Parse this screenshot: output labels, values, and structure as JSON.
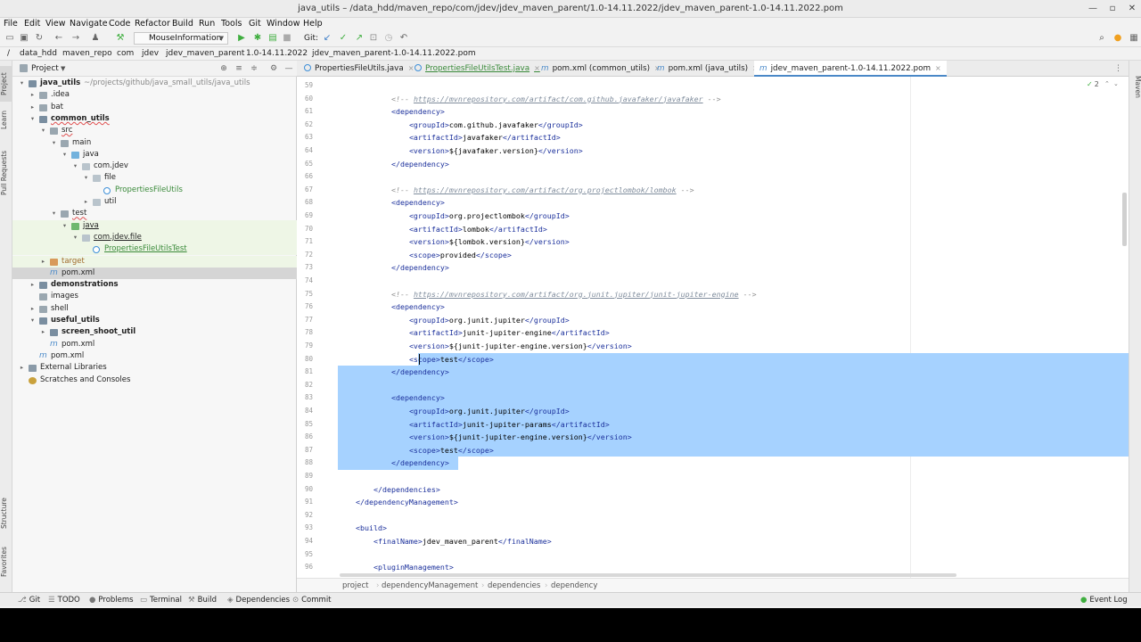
{
  "window": {
    "title": "java_utils – /data_hdd/maven_repo/com/jdev/jdev_maven_parent/1.0-14.11.2022/jdev_maven_parent-1.0-14.11.2022.pom",
    "minimize": "—",
    "maximize": "▫",
    "close": "✕"
  },
  "menu": [
    "File",
    "Edit",
    "View",
    "Navigate",
    "Code",
    "Refactor",
    "Build",
    "Run",
    "Tools",
    "Git",
    "Window",
    "Help"
  ],
  "toolbar": {
    "run_config": "MouseInformation",
    "git_label": "Git:"
  },
  "breadcrumbs": [
    "/",
    "data_hdd",
    "maven_repo",
    "com",
    "jdev",
    "jdev_maven_parent",
    "1.0-14.11.2022",
    "jdev_maven_parent-1.0-14.11.2022.pom"
  ],
  "left_strip": [
    "Project",
    "Learn",
    "Pull Requests",
    "Structure",
    "Favorites"
  ],
  "right_strip": [
    "Maven"
  ],
  "project_panel": {
    "title": "Project",
    "tree": [
      {
        "label": "java_utils",
        "suffix": "~/projects/github/java_small_utils/java_utils",
        "depth": 0,
        "arrow": "▾",
        "icon": "folder mod",
        "bold": true
      },
      {
        "label": ".idea",
        "depth": 1,
        "arrow": "▸",
        "icon": "folder"
      },
      {
        "label": "bat",
        "depth": 1,
        "arrow": "▸",
        "icon": "folder"
      },
      {
        "label": "common_utils",
        "depth": 1,
        "arrow": "▾",
        "icon": "folder mod",
        "bold": true
      },
      {
        "label": "src",
        "depth": 2,
        "arrow": "▾",
        "icon": "folder"
      },
      {
        "label": "main",
        "depth": 3,
        "arrow": "▾",
        "icon": "folder"
      },
      {
        "label": "java",
        "depth": 4,
        "arrow": "▾",
        "icon": "folder src"
      },
      {
        "label": "com.jdev",
        "depth": 5,
        "arrow": "▾",
        "icon": "pkg"
      },
      {
        "label": "file",
        "depth": 6,
        "arrow": "▾",
        "icon": "pkg"
      },
      {
        "label": "PropertiesFileUtils",
        "depth": 7,
        "arrow": "",
        "icon": "cls",
        "color": "#3a8a3a"
      },
      {
        "label": "util",
        "depth": 6,
        "arrow": "▸",
        "icon": "pkg"
      },
      {
        "label": "test",
        "depth": 3,
        "arrow": "▾",
        "icon": "folder"
      },
      {
        "label": "java",
        "depth": 4,
        "arrow": "▾",
        "icon": "folder test",
        "hl": true
      },
      {
        "label": "com.jdev.file",
        "depth": 5,
        "arrow": "▾",
        "icon": "pkg",
        "hl": true
      },
      {
        "label": "PropertiesFileUtilsTest",
        "depth": 6,
        "arrow": "",
        "icon": "cls",
        "color": "#3a8a3a",
        "hl": true
      },
      {
        "label": "target",
        "depth": 2,
        "arrow": "▸",
        "icon": "folder excl",
        "color": "#a06a2a",
        "hl": true
      },
      {
        "label": "pom.xml",
        "depth": 2,
        "arrow": "",
        "icon": "pom",
        "selected": true
      },
      {
        "label": "demonstrations",
        "depth": 1,
        "arrow": "▸",
        "icon": "folder mod",
        "bold": true
      },
      {
        "label": "images",
        "depth": 1,
        "arrow": "",
        "icon": "folder"
      },
      {
        "label": "shell",
        "depth": 1,
        "arrow": "▸",
        "icon": "folder"
      },
      {
        "label": "useful_utils",
        "depth": 1,
        "arrow": "▾",
        "icon": "folder mod",
        "bold": true
      },
      {
        "label": "screen_shoot_util",
        "depth": 2,
        "arrow": "▸",
        "icon": "folder mod",
        "bold": true
      },
      {
        "label": "pom.xml",
        "depth": 2,
        "arrow": "",
        "icon": "pom"
      },
      {
        "label": "pom.xml",
        "depth": 1,
        "arrow": "",
        "icon": "pom"
      },
      {
        "label": "External Libraries",
        "depth": 0,
        "arrow": "▸",
        "icon": "lib"
      },
      {
        "label": "Scratches and Consoles",
        "depth": 0,
        "arrow": "",
        "icon": "scr"
      }
    ]
  },
  "editor_tabs": [
    {
      "label": "PropertiesFileUtils.java",
      "kind": "class",
      "active": false
    },
    {
      "label": "PropertiesFileUtilsTest.java",
      "kind": "test",
      "active": false
    },
    {
      "label": "pom.xml (common_utils)",
      "kind": "pom",
      "active": false
    },
    {
      "label": "pom.xml (java_utils)",
      "kind": "pom",
      "active": false
    },
    {
      "label": "jdev_maven_parent-1.0-14.11.2022.pom",
      "kind": "pom",
      "active": true
    }
  ],
  "editor": {
    "inspection_count": "2",
    "lines": [
      {
        "n": "59",
        "html": ""
      },
      {
        "n": "60",
        "html": "            <span class=\"cm\">&lt;!-- <span class=\"lk\">https://mvnrepository.com/artifact/com.github.javafaker/javafaker</span> --&gt;</span>"
      },
      {
        "n": "61",
        "html": "            <span class=\"tg\">&lt;dependency&gt;</span>"
      },
      {
        "n": "62",
        "html": "                <span class=\"tg\">&lt;groupId&gt;</span>com.github.javafaker<span class=\"tg\">&lt;/groupId&gt;</span>"
      },
      {
        "n": "63",
        "html": "                <span class=\"tg\">&lt;artifactId&gt;</span>javafaker<span class=\"tg\">&lt;/artifactId&gt;</span>"
      },
      {
        "n": "64",
        "html": "                <span class=\"tg\">&lt;version&gt;</span>${javafaker.version}<span class=\"tg\">&lt;/version&gt;</span>"
      },
      {
        "n": "65",
        "html": "            <span class=\"tg\">&lt;/dependency&gt;</span>"
      },
      {
        "n": "66",
        "html": ""
      },
      {
        "n": "67",
        "html": "            <span class=\"cm\">&lt;!-- <span class=\"lk\">https://mvnrepository.com/artifact/org.projectlombok/lombok</span> --&gt;</span>"
      },
      {
        "n": "68",
        "html": "            <span class=\"tg\">&lt;dependency&gt;</span>"
      },
      {
        "n": "69",
        "html": "                <span class=\"tg\">&lt;groupId&gt;</span>org.projectlombok<span class=\"tg\">&lt;/groupId&gt;</span>"
      },
      {
        "n": "70",
        "html": "                <span class=\"tg\">&lt;artifactId&gt;</span>lombok<span class=\"tg\">&lt;/artifactId&gt;</span>"
      },
      {
        "n": "71",
        "html": "                <span class=\"tg\">&lt;version&gt;</span>${lombok.version}<span class=\"tg\">&lt;/version&gt;</span>"
      },
      {
        "n": "72",
        "html": "                <span class=\"tg\">&lt;scope&gt;</span>provided<span class=\"tg\">&lt;/scope&gt;</span>"
      },
      {
        "n": "73",
        "html": "            <span class=\"tg\">&lt;/dependency&gt;</span>"
      },
      {
        "n": "74",
        "html": ""
      },
      {
        "n": "75",
        "html": "            <span class=\"cm\">&lt;!-- <span class=\"lk\">https://mvnrepository.com/artifact/org.junit.jupiter/junit-jupiter-engine</span> --&gt;</span>"
      },
      {
        "n": "76",
        "html": "            <span class=\"tg\">&lt;dependency&gt;</span>"
      },
      {
        "n": "77",
        "html": "                <span class=\"tg\">&lt;groupId&gt;</span>org.junit.jupiter<span class=\"tg\">&lt;/groupId&gt;</span>"
      },
      {
        "n": "78",
        "html": "                <span class=\"tg\">&lt;artifactId&gt;</span>junit-jupiter-engine<span class=\"tg\">&lt;/artifactId&gt;</span>"
      },
      {
        "n": "79",
        "html": "                <span class=\"tg\">&lt;version&gt;</span>${junit-jupiter-engine.version}<span class=\"tg\">&lt;/version&gt;</span>"
      },
      {
        "n": "80",
        "html": "                <span class=\"tg\">&lt;scope&gt;</span>test<span class=\"tg\">&lt;/scope&gt;</span>",
        "sel": "partial"
      },
      {
        "n": "81",
        "html": "            <span class=\"tg\">&lt;/dependency&gt;</span>",
        "sel": "full"
      },
      {
        "n": "82",
        "html": "",
        "sel": "full"
      },
      {
        "n": "83",
        "html": "            <span class=\"tg\">&lt;dependency&gt;</span>",
        "sel": "full"
      },
      {
        "n": "84",
        "html": "                <span class=\"tg\">&lt;groupId&gt;</span>org.junit.jupiter<span class=\"tg\">&lt;/groupId&gt;</span>",
        "sel": "full"
      },
      {
        "n": "85",
        "html": "                <span class=\"tg\">&lt;artifactId&gt;</span>junit-jupiter-params<span class=\"tg\">&lt;/artifactId&gt;</span>",
        "sel": "full"
      },
      {
        "n": "86",
        "html": "                <span class=\"tg\">&lt;version&gt;</span>${junit-jupiter-engine.version}<span class=\"tg\">&lt;/version&gt;</span>",
        "sel": "full"
      },
      {
        "n": "87",
        "html": "                <span class=\"tg\">&lt;scope&gt;</span>test<span class=\"tg\">&lt;/scope&gt;</span>",
        "sel": "full"
      },
      {
        "n": "88",
        "html": "            <span class=\"tg\">&lt;/dependency&gt;</span>",
        "sel": "end"
      },
      {
        "n": "89",
        "html": ""
      },
      {
        "n": "90",
        "html": "        <span class=\"tg\">&lt;/dependencies&gt;</span>"
      },
      {
        "n": "91",
        "html": "    <span class=\"tg\">&lt;/dependencyManagement&gt;</span>"
      },
      {
        "n": "92",
        "html": ""
      },
      {
        "n": "93",
        "html": "    <span class=\"tg\">&lt;build&gt;</span>"
      },
      {
        "n": "94",
        "html": "        <span class=\"tg\">&lt;finalName&gt;</span>jdev_maven_parent<span class=\"tg\">&lt;/finalName&gt;</span>"
      },
      {
        "n": "95",
        "html": ""
      },
      {
        "n": "96",
        "html": "        <span class=\"tg\">&lt;pluginManagement&gt;</span>"
      }
    ]
  },
  "editor_breadcrumbs": [
    "project",
    "dependencyManagement",
    "dependencies",
    "dependency"
  ],
  "bottom_tools": [
    {
      "label": "Git",
      "icon": "⎇"
    },
    {
      "label": "TODO",
      "icon": "☰"
    },
    {
      "label": "Problems",
      "icon": "●"
    },
    {
      "label": "Terminal",
      "icon": "▭"
    },
    {
      "label": "Build",
      "icon": "⚒"
    },
    {
      "label": "Dependencies",
      "icon": "◈"
    },
    {
      "label": "Commit",
      "icon": "⊙"
    }
  ],
  "event_log": "Event Log",
  "colors": {
    "accent": "#4a88c7",
    "selection": "#a6d2ff",
    "tag": "#1a2f9b",
    "comment": "#8c8c8c",
    "run": "#3fae3f"
  }
}
